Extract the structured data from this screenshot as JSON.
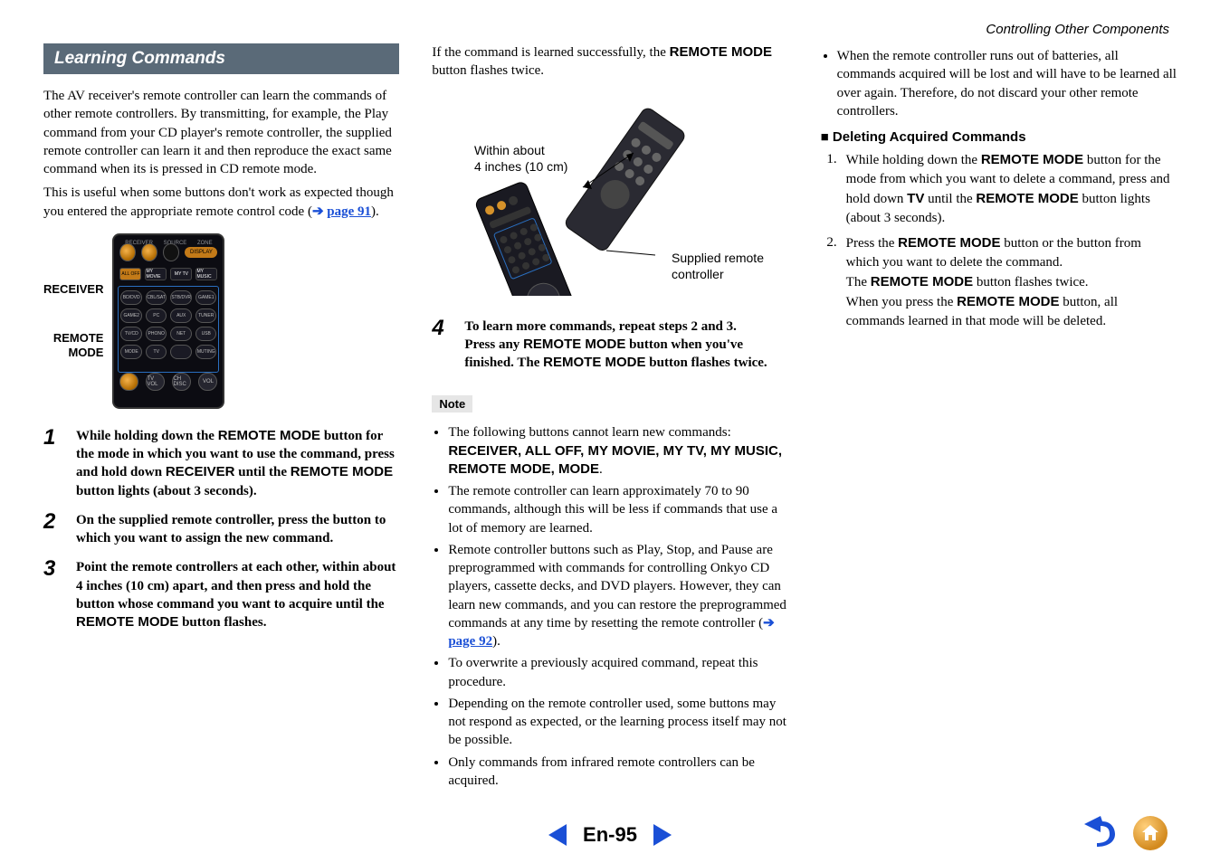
{
  "breadcrumb": "Controlling Other Components",
  "section_bar": "Learning Commands",
  "intro": {
    "p1a": "The AV receiver's remote controller can learn the commands of other remote controllers. By transmitting, for example, the Play command from your CD player's remote controller, the supplied remote controller can learn it and then reproduce the exact same command when its ",
    "p1b": " is pressed in CD remote mode.",
    "p2": "This is useful when some buttons don't work as expected though you entered the appropriate remote control code (",
    "arrow": "➔",
    "link": "page 91",
    "p2end": ")."
  },
  "remote_labels": {
    "receiver": "RECEIVER",
    "remote_mode_line1": "REMOTE",
    "remote_mode_line2": "MODE"
  },
  "remote_buttons": {
    "top_labels": [
      "RECEIVER",
      "SOURCE",
      "ZONE"
    ],
    "top_pill": "DISPLAY",
    "row2": [
      "ALL OFF",
      "MY MOVIE",
      "MY TV",
      "MY MUSIC"
    ],
    "grid": [
      [
        "BD/DVD",
        "CBL/SAT",
        "STB/DVR",
        "GAME1"
      ],
      [
        "GAME2",
        "PC",
        "AUX",
        "TUNER"
      ],
      [
        "TV/CD",
        "PHONO",
        "NET",
        "USB"
      ],
      [
        "MODE",
        "TV",
        "",
        "MUTING"
      ]
    ],
    "bottom": [
      "",
      "TV VOL",
      "CH DISC",
      "VOL"
    ]
  },
  "steps": [
    {
      "n": "1",
      "text_parts": [
        "While holding down the ",
        "REMOTE MODE",
        " button for the mode in which you want to use the command, press and hold down ",
        "RECEIVER",
        " until the ",
        "REMOTE MODE",
        " button lights (about 3 seconds)."
      ]
    },
    {
      "n": "2",
      "text_parts": [
        "On the supplied remote controller, press the button to which you want to assign the new command."
      ]
    },
    {
      "n": "3",
      "text_parts": [
        "Point the remote controllers at each other, within about 4 inches (10 cm) apart, and then press and hold the button whose command you want to acquire until the ",
        "REMOTE MODE",
        " button flashes."
      ]
    }
  ],
  "col2": {
    "top_p_a": "If the command is learned successfully, the ",
    "top_p_b": "REMOTE MODE",
    "top_p_c": " button flashes twice.",
    "fig_within_l1": "Within about",
    "fig_within_l2": "4 inches (10 cm)",
    "fig_caption_l1": "Supplied remote",
    "fig_caption_l2": "controller",
    "step4": {
      "n": "4",
      "l1": "To learn more commands, repeat steps 2 and 3.",
      "l2_a": "Press any ",
      "l2_b": "REMOTE MODE",
      "l2_c": " button when you've finished. The ",
      "l2_d": "REMOTE MODE",
      "l2_e": " button flashes twice."
    },
    "note_label": "Note",
    "bullets": [
      {
        "type": "cmdlist",
        "pre": "The following buttons cannot learn new commands:",
        "bold": "RECEIVER, ALL OFF, MY MOVIE, MY TV, MY MUSIC, REMOTE MODE, MODE",
        "post": "."
      },
      {
        "type": "plain",
        "text": "The remote controller can learn approximately 70 to 90 commands, although this will be less if commands that use a lot of memory are learned."
      },
      {
        "type": "link",
        "pre": "Remote controller buttons such as Play, Stop, and Pause are preprogrammed with commands for controlling Onkyo CD players, cassette decks, and DVD players. However, they can learn new commands, and you can restore the preprogrammed commands at any time by resetting the remote controller (",
        "arrow": "➔",
        "link": "page 92",
        "post": ")."
      },
      {
        "type": "plain",
        "text": "To overwrite a previously acquired command, repeat this procedure."
      },
      {
        "type": "plain",
        "text": "Depending on the remote controller used, some buttons may not respond as expected, or the learning process itself may not be possible."
      },
      {
        "type": "plain",
        "text": "Only commands from infrared remote controllers can be acquired."
      }
    ]
  },
  "col3": {
    "top_bullet": "When the remote controller runs out of batteries, all commands acquired will be lost and will have to be learned all over again. Therefore, do not discard your other remote controllers.",
    "subhead_prefix": "■",
    "subhead": "Deleting Acquired Commands",
    "items": [
      {
        "n": "1.",
        "parts": [
          "While holding down the ",
          "REMOTE MODE",
          " button for the mode from which you want to delete a command, press and hold down ",
          "TV",
          " until the ",
          "REMOTE MODE",
          " button lights (about 3 seconds)."
        ]
      },
      {
        "n": "2.",
        "parts": [
          "Press the ",
          "REMOTE MODE",
          " button or the button from which you want to delete the command.",
          " The ",
          "REMOTE MODE",
          " button flashes twice.",
          " When you press the ",
          "REMOTE MODE",
          " button, all commands learned in that mode will be deleted."
        ]
      }
    ]
  },
  "pager": {
    "label": "En-95"
  }
}
